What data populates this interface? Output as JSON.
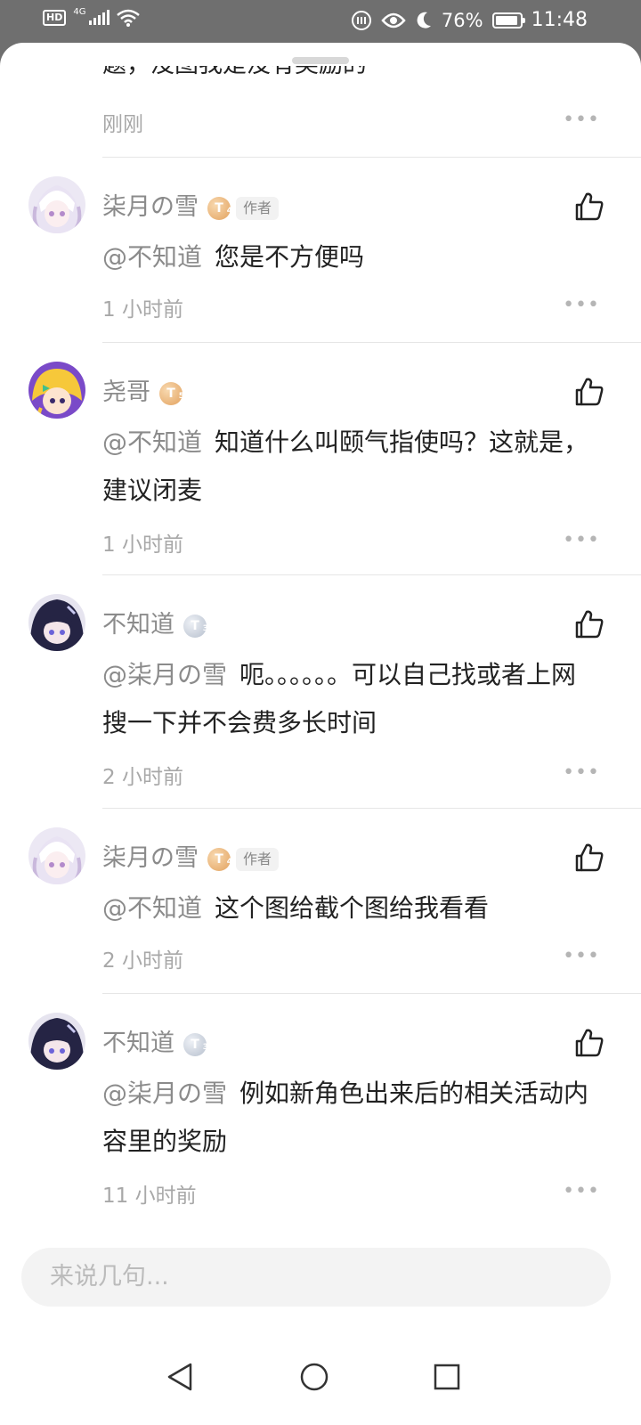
{
  "status_bar": {
    "hd": "HD",
    "network": "4G",
    "battery": "76%",
    "time": "11:48"
  },
  "truncated_comment": {
    "text": "题，没图我是没有奖励的",
    "time": "刚刚"
  },
  "comments": [
    {
      "name": "柒月の雪",
      "level": "4",
      "badge": "gold",
      "tag": "作者",
      "mention": "@不知道",
      "text": "您是不方便吗",
      "time": "1 小时前",
      "avatar": "avatar-white-hair"
    },
    {
      "name": "尧哥",
      "level": "5",
      "badge": "gold",
      "mention": "@不知道",
      "text": "知道什么叫颐气指使吗？这就是，建议闭麦",
      "time": "1 小时前",
      "avatar": "avatar-blonde"
    },
    {
      "name": "不知道",
      "level": "3",
      "badge": "silver",
      "mention": "@柒月の雪",
      "text": "呃。。。。。。可以自己找或者上网搜一下并不会费多长时间",
      "time": "2 小时前",
      "avatar": "avatar-dark-hair"
    },
    {
      "name": "柒月の雪",
      "level": "4",
      "badge": "gold",
      "tag": "作者",
      "mention": "@不知道",
      "text": "这个图给截个图给我看看",
      "time": "2 小时前",
      "avatar": "avatar-white-hair"
    },
    {
      "name": "不知道",
      "level": "3",
      "badge": "silver",
      "mention": "@柒月の雪",
      "text": "例如新角色出来后的相关活动内容里的奖励",
      "time": "11 小时前",
      "avatar": "avatar-dark-hair"
    }
  ],
  "comment_input": {
    "placeholder": "来说几句..."
  },
  "icons": {
    "like": "thumbs-up-icon",
    "more": "more-dots-icon",
    "back": "back-triangle-icon",
    "home": "home-circle-icon",
    "recent": "recent-square-icon"
  },
  "colors": {
    "text": "#222222",
    "secondary": "#8b8b8b",
    "meta": "#a8a8a8",
    "gold_badge": "#e2a15d",
    "silver_badge": "#b6bfcd"
  }
}
